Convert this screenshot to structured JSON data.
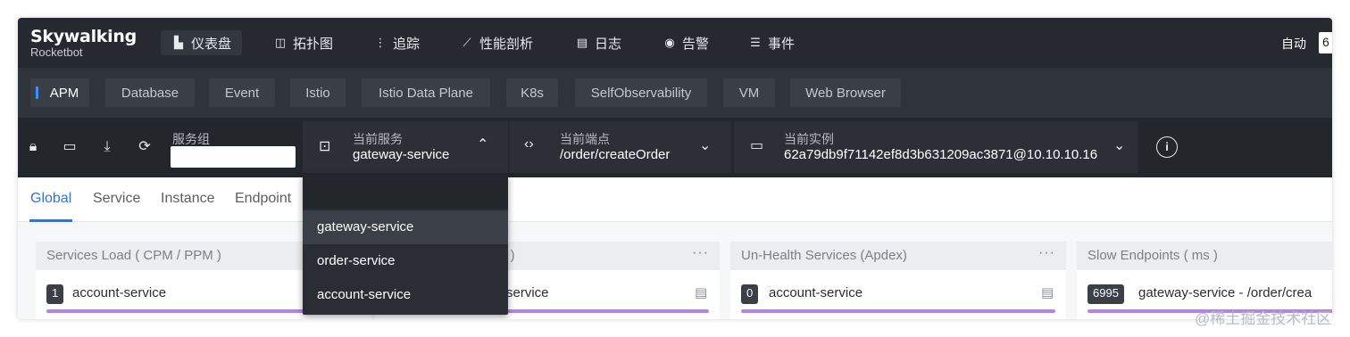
{
  "app": {
    "logo_main": "Skywalking",
    "logo_sub": "Rocketbot"
  },
  "nav": {
    "items": [
      {
        "label": "仪表盘",
        "icon": "dashboard-icon",
        "glyph": "▙",
        "active": true
      },
      {
        "label": "拓扑图",
        "icon": "topology-icon",
        "glyph": "◫",
        "active": false
      },
      {
        "label": "追踪",
        "icon": "trace-icon",
        "glyph": "⋮",
        "active": false
      },
      {
        "label": "性能剖析",
        "icon": "profile-icon",
        "glyph": "⟋",
        "active": false
      },
      {
        "label": "日志",
        "icon": "log-icon",
        "glyph": "▤",
        "active": false
      },
      {
        "label": "告警",
        "icon": "alarm-icon",
        "glyph": "◉",
        "active": false
      },
      {
        "label": "事件",
        "icon": "event-icon",
        "glyph": "☰",
        "active": false
      }
    ],
    "auto_label": "自动",
    "auto_value": "6"
  },
  "layers": [
    "APM",
    "Database",
    "Event",
    "Istio",
    "Istio Data Plane",
    "K8s",
    "SelfObservability",
    "VM",
    "Web Browser"
  ],
  "selectors": {
    "group_label": "服务组",
    "group_value": "",
    "service_label": "当前服务",
    "service_value": "gateway-service",
    "endpoint_label": "当前端点",
    "endpoint_value": "/order/createOrder",
    "instance_label": "当前实例",
    "instance_value": "62a79db9f71142ef8d3b631209ac3871@10.10.10.16"
  },
  "tabs": [
    "Global",
    "Service",
    "Instance",
    "Endpoint"
  ],
  "dropdown": {
    "search_value": "",
    "options": [
      "gateway-service",
      "order-service",
      "account-service"
    ]
  },
  "panels": [
    {
      "title": "Services Load ( CPM / PPM )",
      "badge": "1",
      "row": "account-service"
    },
    {
      "title": "s )",
      "badge": "",
      "row": "service"
    },
    {
      "title": "Un-Health Services (Apdex)",
      "badge": "0",
      "row": "account-service"
    },
    {
      "title": "Slow Endpoints ( ms )",
      "badge": "6995",
      "row": "gateway-service - /order/crea"
    }
  ],
  "watermark": "@稀土掘金技术社区",
  "colors": {
    "accent": "#3a72c8",
    "bar": "#b284e8",
    "nav_bg": "#262a30"
  }
}
